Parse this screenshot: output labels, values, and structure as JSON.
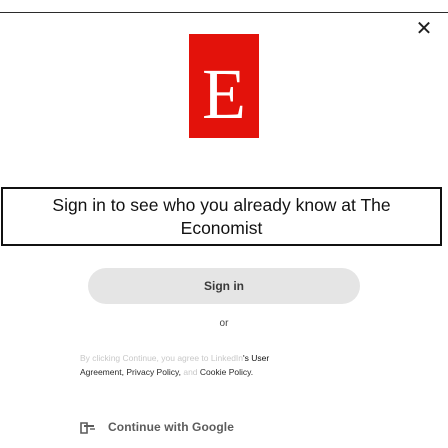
{
  "window": {
    "close_glyph": "✕"
  },
  "logo": {
    "letter": "E",
    "color": "#e3120b"
  },
  "prompt": {
    "text": "Sign in to see who you already know at The Economist"
  },
  "signin_button": {
    "label": "Sign in"
  },
  "divider": {
    "text": "or"
  },
  "legal": {
    "faded_prefix": "By clicking Continue, you agree to LinkedIn",
    "suffix": "'s User",
    "user_agreement": "Agreement",
    "privacy": "Privacy Policy",
    "conjunction": "and",
    "cookie": "Cookie Policy",
    "sep1": ", ",
    "sep2": ", ",
    "end": "."
  },
  "google_button": {
    "label": "Continue with Google",
    "icon": "google-icon"
  },
  "colors": {
    "accent": "#e3120b",
    "button_bg": "#e5e5e5",
    "border": "#111111"
  }
}
